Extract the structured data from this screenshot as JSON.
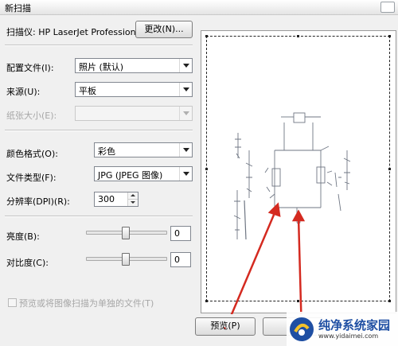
{
  "window": {
    "title": "新扫描"
  },
  "scanner": {
    "label": "扫描仪: HP LaserJet Professional...",
    "change_button": "更改(N)..."
  },
  "profile": {
    "label": "配置文件(I):",
    "value": "照片 (默认)"
  },
  "source": {
    "label": "来源(U):",
    "value": "平板"
  },
  "paper_size": {
    "label": "纸张大小(E):",
    "value": ""
  },
  "color_format": {
    "label": "颜色格式(O):",
    "value": "彩色"
  },
  "file_type": {
    "label": "文件类型(F):",
    "value": "JPG (JPEG 图像)"
  },
  "resolution": {
    "label": "分辨率(DPI)(R):",
    "value": "300"
  },
  "brightness": {
    "label": "亮度(B):",
    "value": "0",
    "level": 0.5
  },
  "contrast": {
    "label": "对比度(C):",
    "value": "0",
    "level": 0.5
  },
  "separate_files": {
    "label": "预览或将图像扫描为单独的文件(T)",
    "checked": false
  },
  "buttons": {
    "preview": "预览(P)"
  },
  "watermark": {
    "text": "纯净系统家园",
    "url": "www.yidaimei.com"
  },
  "colors": {
    "annotation_arrow": "#d42a20",
    "watermark_brand": "#1f4fa3"
  }
}
